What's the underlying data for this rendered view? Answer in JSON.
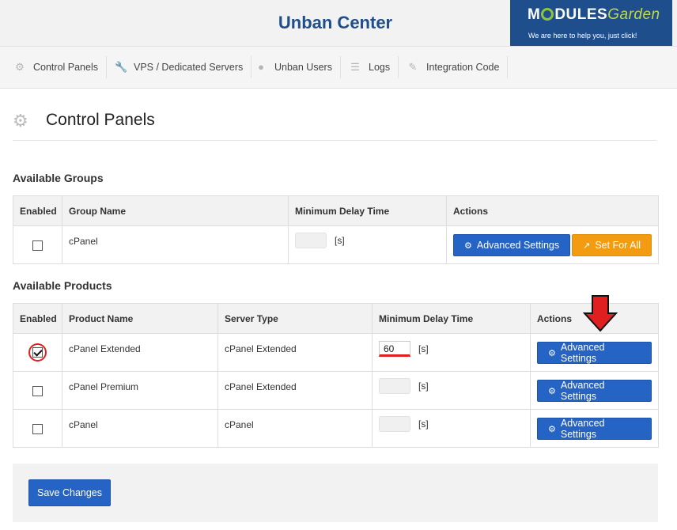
{
  "header": {
    "title": "Unban Center",
    "logo": {
      "brand_a": "M",
      "brand_b": "DULES",
      "brand_c": "Garden",
      "tagline": "We are here to help you, just click!",
      "colors": {
        "background": "#1f4e8c",
        "ring": "#8cc640",
        "garden": "#c2d84a"
      }
    }
  },
  "nav": {
    "items": [
      {
        "label": "Control Panels",
        "icon": "gear-icon"
      },
      {
        "label": "VPS / Dedicated Servers",
        "icon": "wrench-icon"
      },
      {
        "label": "Unban Users",
        "icon": "user-icon"
      },
      {
        "label": "Logs",
        "icon": "list-icon"
      },
      {
        "label": "Integration Code",
        "icon": "pencil-icon"
      }
    ]
  },
  "page": {
    "title": "Control Panels",
    "icon": "gear-icon"
  },
  "groups": {
    "title": "Available Groups",
    "columns": [
      "Enabled",
      "Group Name",
      "Minimum Delay Time",
      "Actions"
    ],
    "rows": [
      {
        "enabled": false,
        "name": "cPanel",
        "delay": "",
        "unit": "[s]",
        "advanced_label": "Advanced Settings",
        "set_all_label": "Set For All"
      }
    ]
  },
  "products": {
    "title": "Available Products",
    "columns": [
      "Enabled",
      "Product Name",
      "Server Type",
      "Minimum Delay Time",
      "Actions"
    ],
    "rows": [
      {
        "enabled": true,
        "name": "cPanel Extended",
        "server_type": "cPanel Extended",
        "delay": "60",
        "unit": "[s]",
        "advanced_label": "Advanced Settings"
      },
      {
        "enabled": false,
        "name": "cPanel Premium",
        "server_type": "cPanel Extended",
        "delay": "",
        "unit": "[s]",
        "advanced_label": "Advanced Settings"
      },
      {
        "enabled": false,
        "name": "cPanel",
        "server_type": "cPanel",
        "delay": "",
        "unit": "[s]",
        "advanced_label": "Advanced Settings"
      }
    ]
  },
  "footer": {
    "save_label": "Save Changes"
  },
  "colors": {
    "accent_blue": "#2563c4",
    "title_blue": "#1f4e8c",
    "orange": "#f39c12",
    "highlight_red": "#e02020"
  }
}
